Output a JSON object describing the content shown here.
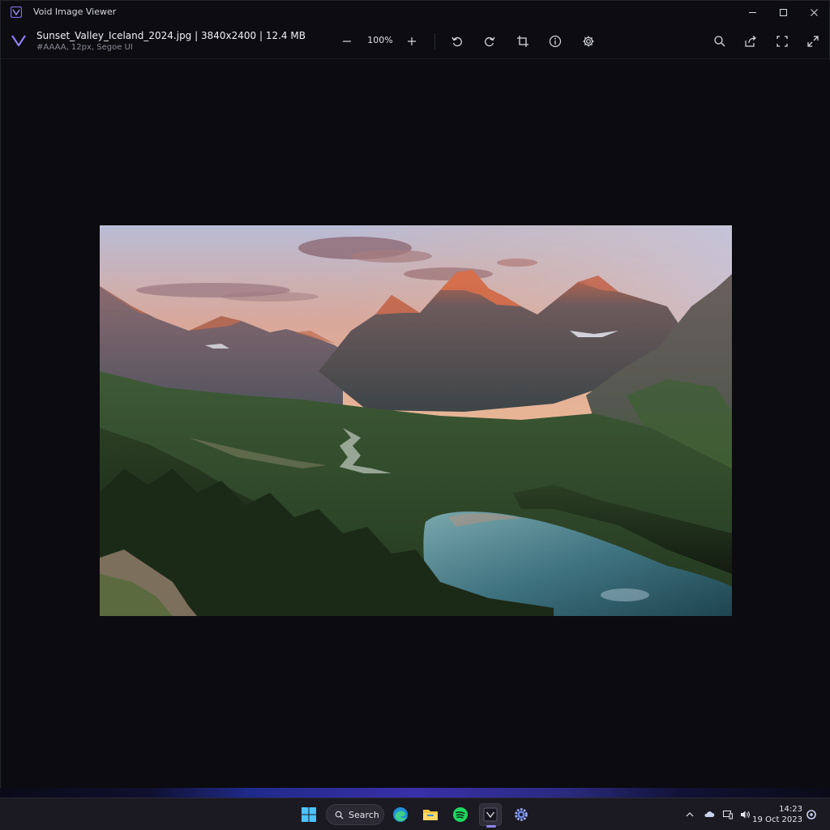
{
  "window": {
    "app_title": "Void Image Viewer"
  },
  "toolbar": {
    "file_title": "Sunset_Valley_Iceland_2024.jpg | 3840x2400 | 12.4 MB",
    "file_subtitle": "#AAAA, 12px, Segoe UI",
    "zoom_level": "100%",
    "tools": [
      "zoom-out-icon",
      "zoom-in-icon",
      "rotate-left-icon",
      "rotate-right-icon",
      "crop-icon",
      "info-icon",
      "gear-icon",
      "search-icon",
      "share-icon",
      "fit-screen-icon",
      "fullscreen-icon"
    ]
  },
  "taskbar": {
    "search_label": "Search",
    "time": "14:23",
    "date": "19 Oct 2023",
    "accent_color": "#8e86e8"
  },
  "colors": {
    "brand": "#7f6ff0",
    "canvas_bg": "#0b0b10",
    "taskbar_bg": "#1b1a22"
  }
}
